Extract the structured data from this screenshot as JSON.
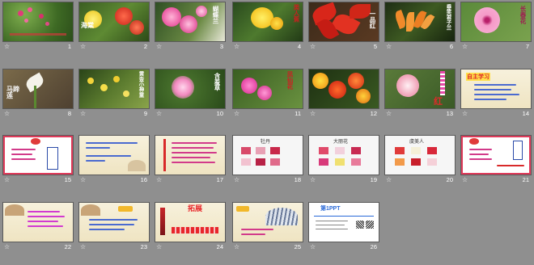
{
  "slides": [
    {
      "number": "1",
      "labels": []
    },
    {
      "number": "2",
      "labels": [
        "海棠"
      ]
    },
    {
      "number": "3",
      "labels": [
        "蝴蝶兰"
      ]
    },
    {
      "number": "4",
      "labels": [
        "美人蕉"
      ]
    },
    {
      "number": "5",
      "labels": [
        "一品红"
      ]
    },
    {
      "number": "6",
      "labels": [
        "垂笑君子兰"
      ]
    },
    {
      "number": "7",
      "labels": [
        "长春花"
      ]
    },
    {
      "number": "8",
      "labels": [
        "马蹄莲"
      ]
    },
    {
      "number": "9",
      "labels": [
        "黄金小神童"
      ]
    },
    {
      "number": "10",
      "labels": [
        "含羞草"
      ]
    },
    {
      "number": "11",
      "labels": [
        "凤仙花"
      ]
    },
    {
      "number": "12",
      "labels": []
    },
    {
      "number": "13",
      "labels": [
        "红"
      ]
    },
    {
      "number": "14",
      "labels": [
        "自主学习"
      ]
    },
    {
      "number": "15",
      "labels": []
    },
    {
      "number": "16",
      "labels": []
    },
    {
      "number": "17",
      "labels": []
    },
    {
      "number": "18",
      "labels": [
        "牡丹"
      ]
    },
    {
      "number": "19",
      "labels": [
        "大丽花"
      ]
    },
    {
      "number": "20",
      "labels": [
        "虞美人"
      ]
    },
    {
      "number": "21",
      "labels": []
    },
    {
      "number": "22",
      "labels": []
    },
    {
      "number": "23",
      "labels": []
    },
    {
      "number": "24",
      "labels": [
        "拓展"
      ]
    },
    {
      "number": "25",
      "labels": []
    },
    {
      "number": "26",
      "labels": [
        "第1PPT"
      ]
    }
  ],
  "star_glyph": "☆"
}
